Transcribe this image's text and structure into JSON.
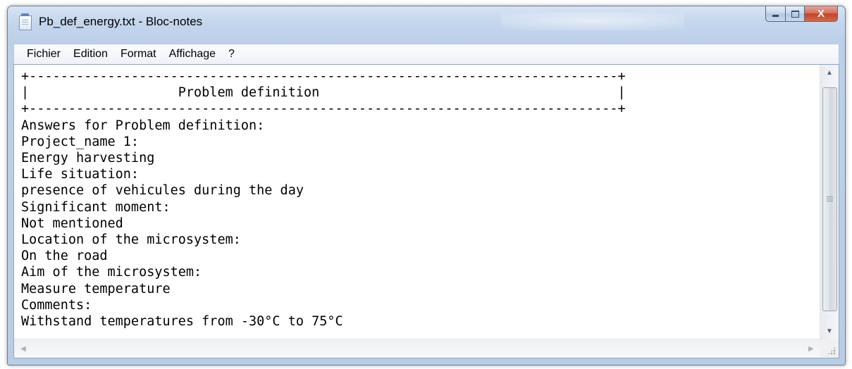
{
  "window": {
    "title": "Pb_def_energy.txt - Bloc-notes",
    "app_icon": "notepad-icon",
    "controls": {
      "minimize_icon": "minimize-icon",
      "maximize_icon": "maximize-icon",
      "close_icon": "close-icon",
      "close_glyph": "X"
    }
  },
  "menu": {
    "items": [
      {
        "label": "Fichier"
      },
      {
        "label": "Edition"
      },
      {
        "label": "Format"
      },
      {
        "label": "Affichage"
      },
      {
        "label": "?"
      }
    ]
  },
  "editor": {
    "content": "+---------------------------------------------------------------------------+\n|                   Problem definition                                      |\n+---------------------------------------------------------------------------+\nAnswers for Problem definition:\nProject_name 1:\nEnergy harvesting\nLife situation:\npresence of vehicules during the day\nSignificant moment:\nNot mentioned\nLocation of the microsystem:\nOn the road\nAim of the microsystem:\nMeasure temperature\nComments:\nWithstand temperatures from -30°C to 75°C"
  },
  "scrollbars": {
    "vertical": {
      "up_icon": "scroll-up-arrow-icon",
      "down_icon": "scroll-down-arrow-icon",
      "grip_icon": "grip-icon"
    },
    "horizontal": {
      "left_icon": "scroll-left-arrow-icon",
      "right_icon": "scroll-right-arrow-icon"
    }
  },
  "colors": {
    "title_bar": "#c2d5ec",
    "close_button": "#c44326",
    "editor_background": "#ffffff"
  }
}
